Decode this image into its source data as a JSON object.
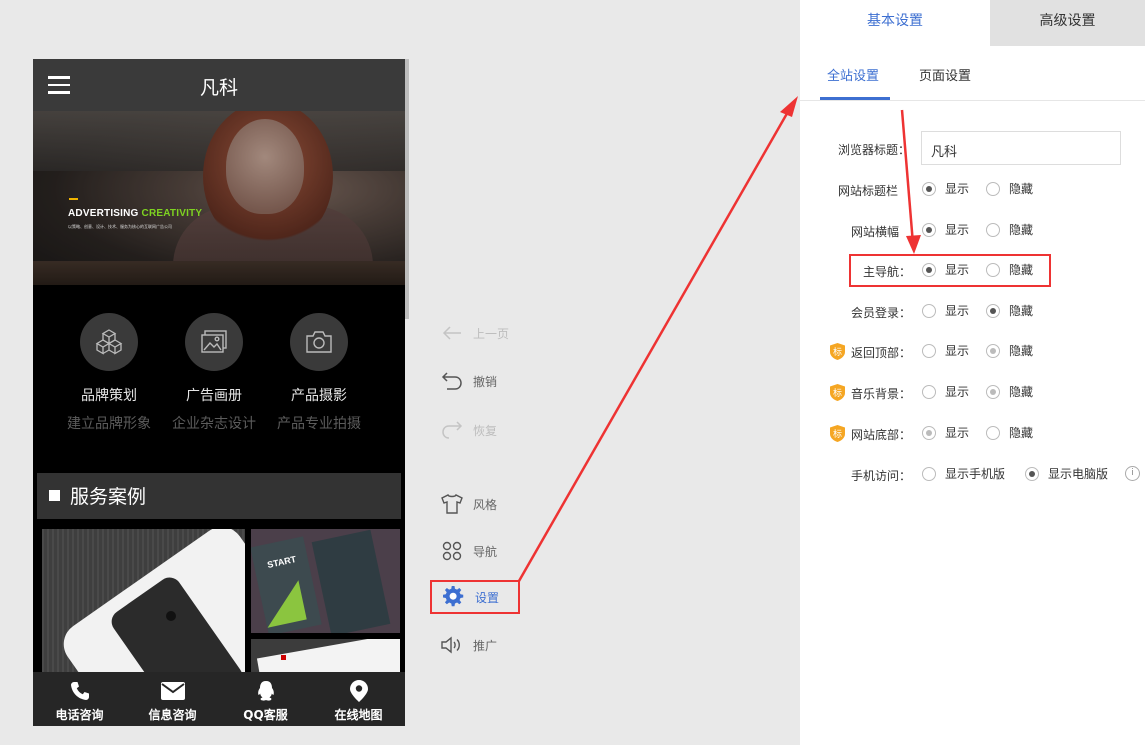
{
  "phone": {
    "title": "凡科",
    "banner": {
      "headline_a": "ADVERTISING ",
      "headline_b": "CREATIVITY",
      "subline": "以策略、创意、设计、技术、服务为核心的互联网广告公司"
    },
    "features": [
      {
        "name": "品牌策划",
        "desc": "建立品牌形象",
        "icon": "cubes-icon"
      },
      {
        "name": "广告画册",
        "desc": "企业杂志设计",
        "icon": "picture-icon"
      },
      {
        "name": "产品摄影",
        "desc": "产品专业拍摄",
        "icon": "camera-icon"
      }
    ],
    "cases_title": "服务案例",
    "case_card_text": "START",
    "footer": [
      {
        "label": "电话咨询",
        "icon": "phone-icon"
      },
      {
        "label": "信息咨询",
        "icon": "mail-icon"
      },
      {
        "label": "QQ客服",
        "icon": "qq-icon"
      },
      {
        "label": "在线地图",
        "icon": "map-pin-icon"
      }
    ]
  },
  "tools": {
    "prev": "上一页",
    "undo": "撤销",
    "redo": "恢复",
    "style": "风格",
    "nav": "导航",
    "settings": "设置",
    "promote": "推广"
  },
  "panel": {
    "tab_basic": "基本设置",
    "tab_advanced": "高级设置",
    "subtab_site": "全站设置",
    "subtab_page": "页面设置",
    "browser_title_label": "浏览器标题：",
    "browser_title_value": "凡科",
    "show": "显示",
    "hide": "隐藏",
    "rows": {
      "site_title_bar": {
        "label": "网站标题栏",
        "selected": "show"
      },
      "site_banner": {
        "label": "网站横幅",
        "selected": "show"
      },
      "main_nav": {
        "label": "主导航：",
        "selected": "show"
      },
      "member_login": {
        "label": "会员登录：",
        "selected": "hide"
      },
      "back_to_top": {
        "label": "返回顶部：",
        "selected": "hide"
      },
      "music_bg": {
        "label": "音乐背景：",
        "selected": "hide"
      },
      "site_footer": {
        "label": "网站底部：",
        "selected": "show"
      }
    },
    "mobile_access_label": "手机访问：",
    "mobile_option_a": "显示手机版",
    "mobile_option_b": "显示电脑版",
    "badge_char": "标",
    "info_char": "i"
  },
  "colors": {
    "accent": "#3d6fd1",
    "highlight_red": "#e33333",
    "badge": "#f5a623",
    "banner_green": "#7ed321"
  }
}
